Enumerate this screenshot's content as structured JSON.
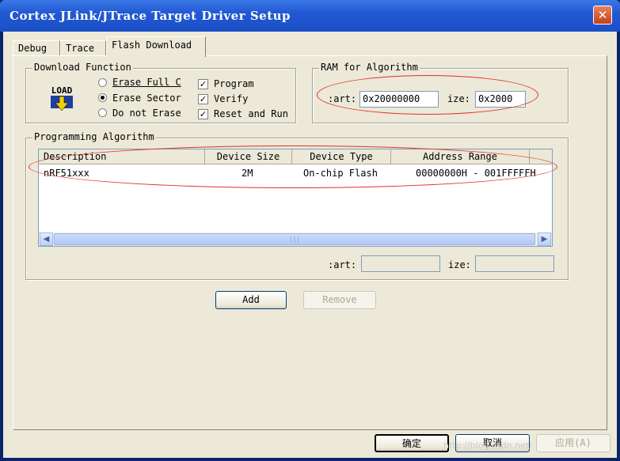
{
  "window": {
    "title": "Cortex JLink/JTrace Target Driver Setup",
    "close_glyph": "✕"
  },
  "tabs": [
    {
      "label": "Debug"
    },
    {
      "label": "Trace"
    },
    {
      "label": "Flash Download",
      "active": true
    }
  ],
  "download_function": {
    "legend": "Download Function",
    "icon_label": "LOAD",
    "radios": [
      {
        "label": "Erase Full C",
        "selected": false
      },
      {
        "label": "Erase Sector",
        "selected": true
      },
      {
        "label": "Do not Erase",
        "selected": false
      }
    ],
    "checks": [
      {
        "label": "Program",
        "checked": true
      },
      {
        "label": "Verify",
        "checked": true
      },
      {
        "label": "Reset and Run",
        "checked": true
      }
    ]
  },
  "ram": {
    "legend": "RAM for Algorithm",
    "start_label": ":art:",
    "start_value": "0x20000000",
    "size_label": "ize:",
    "size_value": "0x2000"
  },
  "programming": {
    "legend": "Programming Algorithm",
    "columns": [
      "Description",
      "Device Size",
      "Device Type",
      "Address Range"
    ],
    "rows": [
      {
        "description": "nRF51xxx",
        "size": "2M",
        "type": "On-chip Flash",
        "range": "00000000H - 001FFFFFH"
      }
    ],
    "start_label": ":art:",
    "size_label": "ize:",
    "start_value": "",
    "size_value": ""
  },
  "buttons": {
    "add": "Add",
    "remove": "Remove",
    "ok": "确定",
    "cancel": "取消",
    "apply": "应用(A)"
  },
  "watermark": "http://blog.csdn.net/",
  "colors": {
    "accent": "#2159d4",
    "highlight": "#e03030",
    "face": "#ece9d8"
  }
}
